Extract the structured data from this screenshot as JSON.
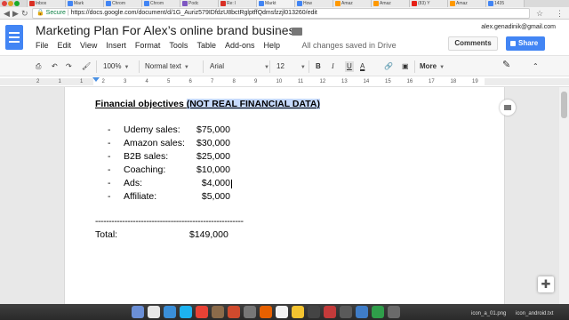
{
  "browser": {
    "tabs": [
      "Inbox",
      "Mark",
      "Chrom",
      "Chrom",
      "Podc",
      "Re: l",
      "Markt",
      "How",
      "Amaz",
      "Amaz",
      "(83) Y",
      "Amaz",
      "1435"
    ],
    "active_tab_index": 6,
    "secure_label": "Secure",
    "url": "https://docs.google.com/document/d/1G_Auriz579IDfdzU8bctRglptffQdmsfzzjl013260/edit"
  },
  "docs": {
    "title": "Marketing Plan For Alex’s online brand business",
    "menus": [
      "File",
      "Edit",
      "View",
      "Insert",
      "Format",
      "Tools",
      "Table",
      "Add-ons",
      "Help"
    ],
    "save_status": "All changes saved in Drive",
    "account_email": "alex.genadinik@gmail.com",
    "comments_label": "Comments",
    "share_label": "Share",
    "brand_color": "#4285f4"
  },
  "toolbar": {
    "zoom": "100%",
    "style": "Normal text",
    "font": "Arial",
    "font_size": "12",
    "bold": "B",
    "italic": "I",
    "underline": "U",
    "text_color": "A",
    "more_label": "More"
  },
  "ruler": {
    "numbers": [
      "2",
      "1",
      "1",
      "2",
      "3",
      "4",
      "5",
      "6",
      "7",
      "8",
      "9",
      "10",
      "11",
      "12",
      "13",
      "14",
      "15",
      "16",
      "17",
      "18",
      "19"
    ]
  },
  "document": {
    "heading_prefix": "Financial objectives ",
    "heading_highlight": "(NOT REAL FINANCIAL DATA)",
    "items": [
      {
        "dash": "-",
        "label": "Udemy sales:",
        "amount": "$75,000"
      },
      {
        "dash": "-",
        "label": "Amazon sales:",
        "amount": "$30,000"
      },
      {
        "dash": "-",
        "label": "B2B sales:",
        "amount": "$25,000"
      },
      {
        "dash": "-",
        "label": "Coaching:",
        "amount": "$10,000"
      },
      {
        "dash": "-",
        "label": "Ads:",
        "amount": "$4,000"
      },
      {
        "dash": "-",
        "label": "Affiliate:",
        "amount": "$5,000"
      }
    ],
    "separator": "-------------------------------------------------------",
    "total_label": "Total:",
    "total_amount": "$149,000"
  },
  "dock": {
    "files": [
      "icon_a_01.png",
      "icon_android.txt"
    ]
  }
}
